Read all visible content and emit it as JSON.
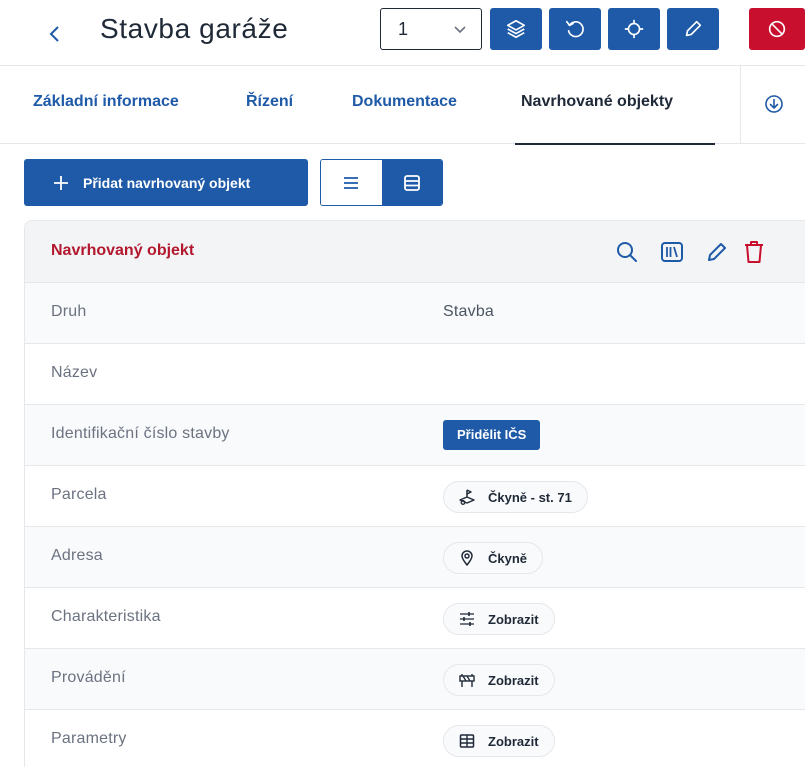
{
  "header": {
    "title": "Stavba garáže",
    "selector_value": "1"
  },
  "tabs": [
    {
      "label": "Základní informace"
    },
    {
      "label": "Řízení"
    },
    {
      "label": "Dokumentace"
    },
    {
      "label": "Navrhované objekty"
    }
  ],
  "active_tab": "Navrhované objekty",
  "actions": {
    "add_label": "Přidat navrhovaný objekt"
  },
  "card": {
    "title": "Navrhovaný objekt",
    "rows": [
      {
        "label": "Druh",
        "value": "Stavba"
      },
      {
        "label": "Název",
        "value": ""
      },
      {
        "label": "Identifikační číslo stavby",
        "button": "Přidělit IČS"
      },
      {
        "label": "Parcela",
        "chip": "Čkyně - st. 71",
        "icon": "parcel-icon"
      },
      {
        "label": "Adresa",
        "chip": "Čkyně",
        "icon": "location-pin-icon"
      },
      {
        "label": "Charakteristika",
        "chip": "Zobrazit",
        "icon": "sliders-icon"
      },
      {
        "label": "Provádění",
        "chip": "Zobrazit",
        "icon": "roadblock-icon"
      },
      {
        "label": "Parametry",
        "chip": "Zobrazit",
        "icon": "table-icon"
      }
    ]
  },
  "colors": {
    "primary": "#1e5aa8",
    "danger": "#c8102e",
    "card_title": "#b3192e"
  }
}
